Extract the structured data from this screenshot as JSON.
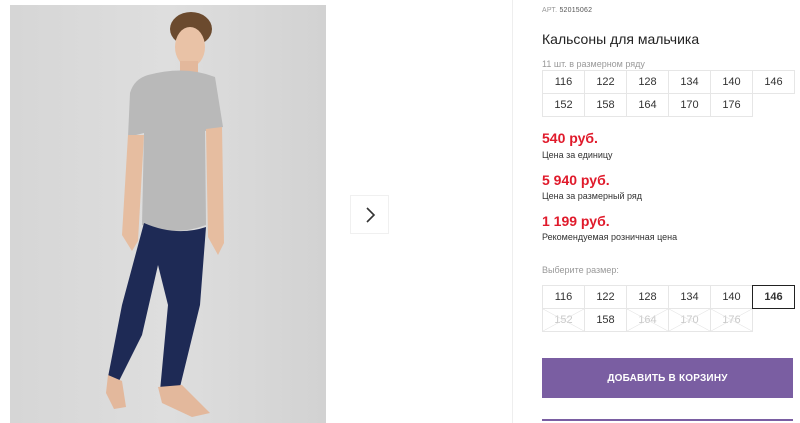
{
  "product": {
    "article_label": "АРТ.",
    "article_code": "52015062",
    "title": "Кальсоны для мальчика"
  },
  "pack": {
    "note": "11 шт. в размерном ряду",
    "sizes": [
      "116",
      "122",
      "128",
      "134",
      "140",
      "146",
      "152",
      "158",
      "164",
      "170",
      "176"
    ]
  },
  "prices": {
    "unit_price": "540 руб.",
    "unit_label": "Цена за единицу",
    "pack_price": "5 940 руб.",
    "pack_label": "Цена за размерный ряд",
    "retail_price": "1 199 руб.",
    "retail_label": "Рекомендуемая розничная цена"
  },
  "size_select": {
    "label": "Выберите размер:",
    "selected": "146",
    "sizes": [
      {
        "value": "116",
        "available": true
      },
      {
        "value": "122",
        "available": true
      },
      {
        "value": "128",
        "available": true
      },
      {
        "value": "134",
        "available": true
      },
      {
        "value": "140",
        "available": true
      },
      {
        "value": "146",
        "available": true
      },
      {
        "value": "152",
        "available": false
      },
      {
        "value": "158",
        "available": true
      },
      {
        "value": "164",
        "available": false
      },
      {
        "value": "170",
        "available": false
      },
      {
        "value": "176",
        "available": false
      }
    ]
  },
  "cart": {
    "add_label": "ДОБАВИТЬ В КОРЗИНУ"
  },
  "colors": {
    "accent": "#7a5ea2",
    "price": "#e01a2b"
  },
  "icons": {
    "next": "chevron-right-icon"
  }
}
